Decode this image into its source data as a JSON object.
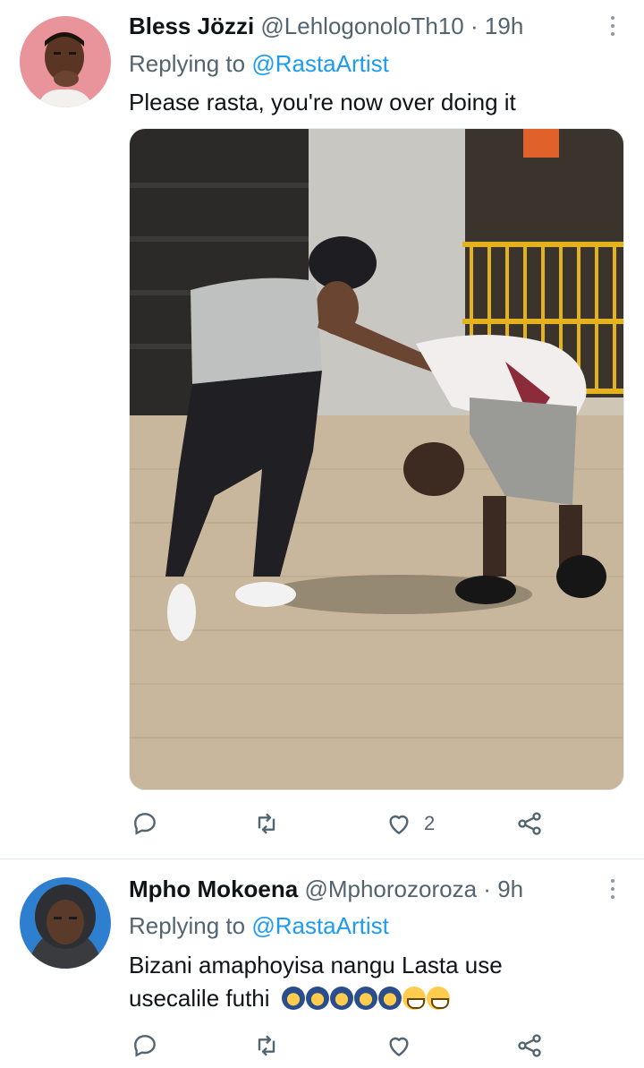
{
  "tweets": [
    {
      "display_name": "Bless Jözzi",
      "handle": "@LehlogonoloTh10",
      "separator": "·",
      "time": "19h",
      "replying_prefix": "Replying to",
      "replying_to": "@RastaArtist",
      "text": "Please rasta, you're now over doing it",
      "likes": "2"
    },
    {
      "display_name": "Mpho Mokoena",
      "handle": "@Mphorozoroza",
      "separator": "·",
      "time": "9h",
      "replying_prefix": "Replying to",
      "replying_to": "@RastaArtist",
      "text_line1": "Bizani amaphoyisa nangu Lasta use",
      "text_line2": "usecalile futhi",
      "emojis": [
        "person-bowing",
        "person-bowing",
        "person-bowing",
        "person-bowing",
        "person-bowing",
        "grinning-face",
        "grinning-face"
      ]
    }
  ],
  "icons": {
    "reply": "reply-icon",
    "retweet": "retweet-icon",
    "like": "heart-icon",
    "share": "share-icon",
    "more": "more-vertical-icon"
  },
  "colors": {
    "accent": "#1d9bf0",
    "secondary_text": "#536471",
    "primary_text": "#0f1419",
    "divider": "#e1e8ed"
  }
}
